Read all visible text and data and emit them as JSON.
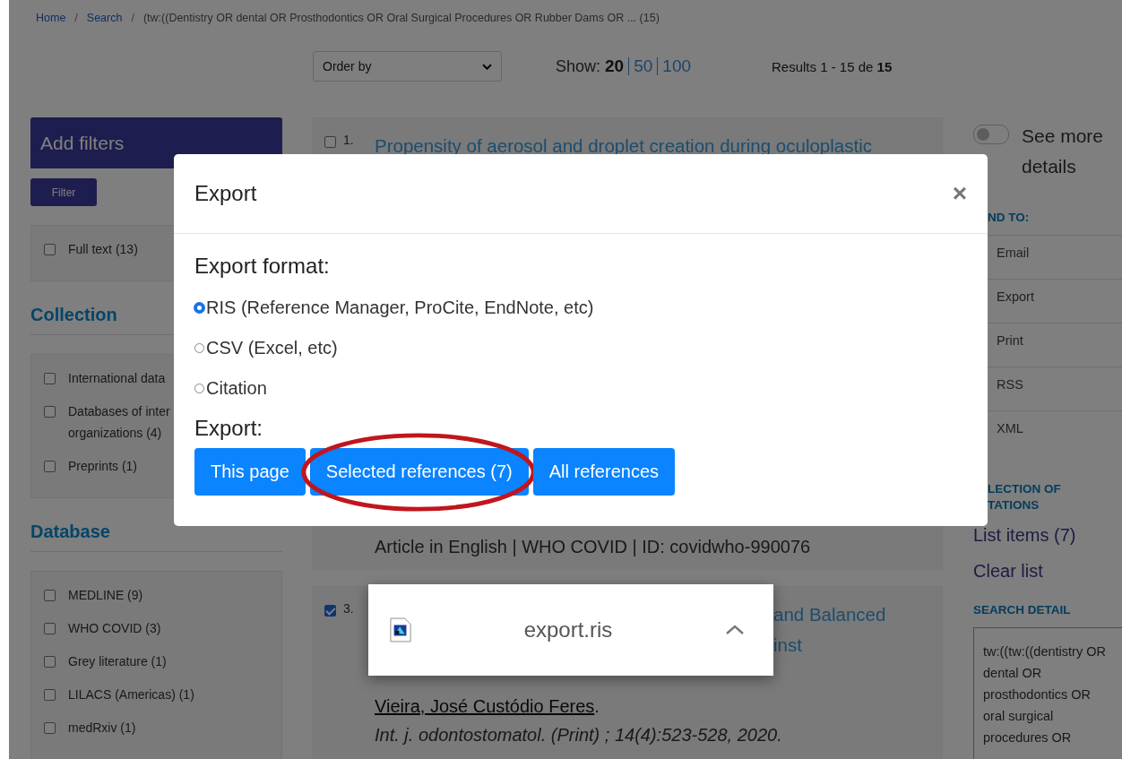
{
  "breadcrumb": {
    "separator": "/",
    "links": [
      "Home",
      "Search"
    ],
    "current": "(tw:((Dentistry OR dental OR Prosthodontics OR Oral Surgical Procedures OR Rubber Dams OR ... (15)"
  },
  "toolbar": {
    "order_by": "Order by",
    "show_label": "Show:",
    "page_sizes": [
      {
        "label": "20",
        "selected": true
      },
      {
        "label": "50",
        "selected": false
      },
      {
        "label": "100",
        "selected": false
      }
    ],
    "results": "Results 1 - 15 de **15**"
  },
  "filters": {
    "title": "Add filters",
    "button": "Filter",
    "top_items": [
      {
        "label": "Full text (13)",
        "checked": false
      }
    ],
    "sections": [
      {
        "title": "Collection",
        "items": [
          {
            "label": "International data",
            "checked": false
          },
          {
            "label": "Databases of inter\norganizations (4)",
            "checked": false
          },
          {
            "label": "Preprints (1)",
            "checked": false
          }
        ]
      },
      {
        "title": "Database",
        "items": [
          {
            "label": "MEDLINE (9)",
            "checked": false
          },
          {
            "label": "WHO COVID (3)",
            "checked": false
          },
          {
            "label": "Grey literature (1)",
            "checked": false
          },
          {
            "label": "LILACS (Americas) (1)",
            "checked": false
          },
          {
            "label": "medRxiv (1)",
            "checked": false
          }
        ]
      }
    ]
  },
  "results": [
    {
      "number": "1.",
      "checked": false,
      "title_lines": [
        "Propensity of aerosol and droplet creation during oculoplastic"
      ]
    },
    {
      "meta": "Article in English | WHO COVID | ID: covidwho-990076"
    },
    {
      "number": "3.",
      "checked": true,
      "title_fragments": [
        "and Balanced",
        "inst"
      ],
      "author": "Vieira, José Custódio Feres",
      "author_end": ".",
      "journal": "Int. j. odontostomatol. (Print) ; 14(4):523-528, 2020."
    }
  ],
  "right": {
    "toggle": {
      "label": "See more details",
      "on": false
    },
    "send_to": {
      "title": "ND TO:",
      "items": [
        "Email",
        "Export",
        "Print",
        "RSS",
        "XML"
      ]
    },
    "collection": {
      "title_lines": [
        "LECTION OF",
        "TATIONS"
      ],
      "links": [
        "List items (7)",
        "Clear list"
      ]
    },
    "search_detail": {
      "title": "SEARCH DETAIL",
      "text": "tw:((tw:((dentistry OR dental OR prosthodontics OR oral surgical procedures OR"
    }
  },
  "modal": {
    "title": "Export",
    "close": "×",
    "format_label": "Export format:",
    "formats": [
      {
        "label": "RIS (Reference Manager, ProCite, EndNote, etc)",
        "selected": true
      },
      {
        "label": "CSV (Excel, etc)",
        "selected": false
      },
      {
        "label": "Citation",
        "selected": false
      }
    ],
    "export_label": "Export:",
    "buttons": [
      {
        "label": "This page",
        "circled": false
      },
      {
        "label": "Selected references (7)",
        "circled": true
      },
      {
        "label": "All references",
        "circled": false
      }
    ]
  },
  "download": {
    "filename": "export.ris"
  }
}
